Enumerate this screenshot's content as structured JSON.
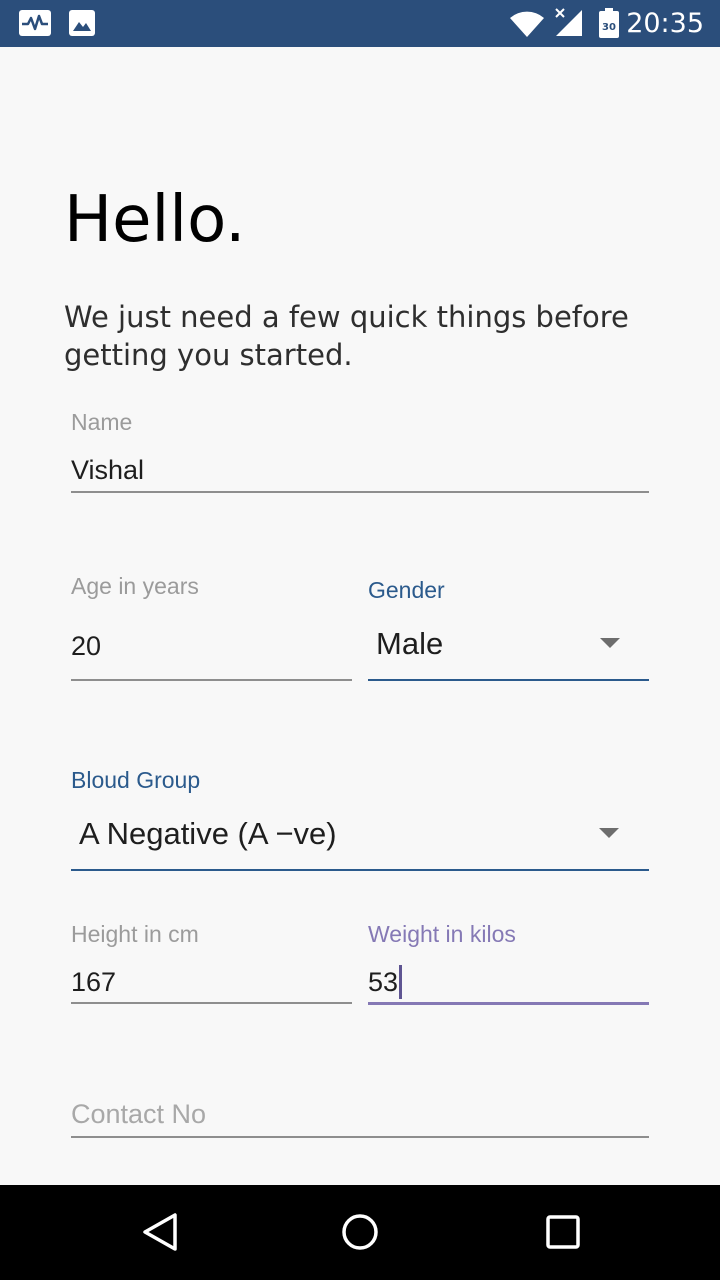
{
  "status_bar": {
    "time": "20:35",
    "battery_level": "30",
    "icons": [
      "pulse-app-icon",
      "image-icon",
      "wifi-icon",
      "cell-signal-icon",
      "battery-icon"
    ],
    "background_color": "#2b4e7b"
  },
  "page": {
    "title": "Hello.",
    "subtitle": "We just need a few quick things before getting you started."
  },
  "form": {
    "name": {
      "label": "Name",
      "value": "Vishal"
    },
    "age": {
      "label": "Age in years",
      "value": "20"
    },
    "gender": {
      "label": "Gender",
      "value": "Male"
    },
    "blood_group": {
      "label": "Bloud Group",
      "value": "A Negative (A −ve)"
    },
    "height": {
      "label": "Height in cm",
      "value": "167"
    },
    "weight": {
      "label": "Weight in kilos",
      "value": "53"
    },
    "contact": {
      "placeholder": "Contact No",
      "value": ""
    }
  },
  "colors": {
    "accent_blue": "#2b5a8c",
    "accent_purple": "#8579b5",
    "label_gray": "#9b9b9b"
  },
  "nav_bar": {
    "buttons": [
      "back-icon",
      "home-icon",
      "recents-icon"
    ]
  }
}
